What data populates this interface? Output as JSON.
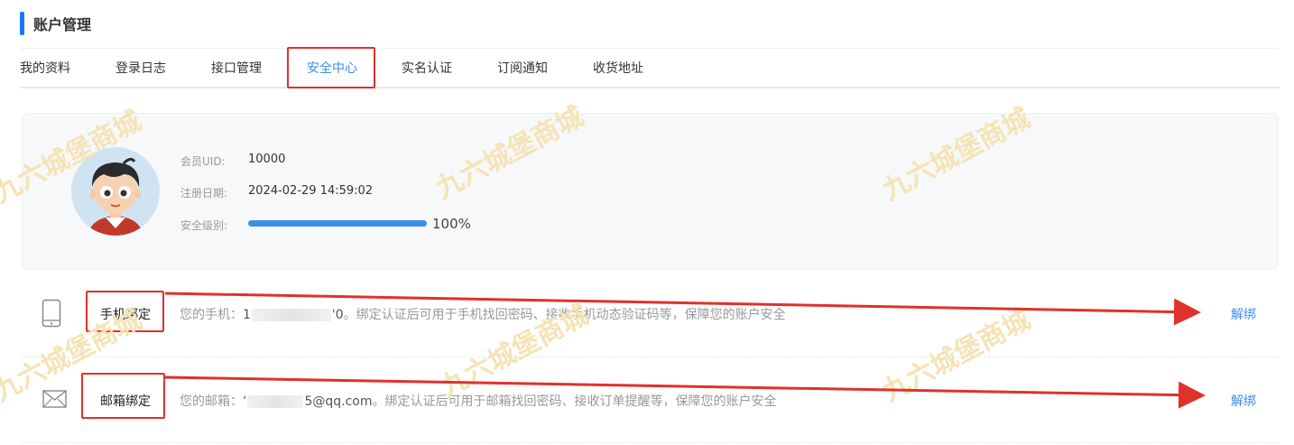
{
  "header": {
    "title": "账户管理"
  },
  "tabs": [
    {
      "label": "我的资料",
      "active": false
    },
    {
      "label": "登录日志",
      "active": false
    },
    {
      "label": "接口管理",
      "active": false
    },
    {
      "label": "安全中心",
      "active": true
    },
    {
      "label": "实名认证",
      "active": false
    },
    {
      "label": "订阅通知",
      "active": false
    },
    {
      "label": "收货地址",
      "active": false
    }
  ],
  "profile": {
    "uid_label": "会员UID:",
    "uid_value": "10000",
    "register_label": "注册日期:",
    "register_value": "2024-02-29 14:59:02",
    "security_label": "安全级别:",
    "security_level": 1.0,
    "security_text": "100%"
  },
  "bindings": {
    "phone": {
      "icon": "phone-icon",
      "title": "手机绑定",
      "prefix": "您的手机：",
      "masked_start": "1",
      "masked_end": "'0",
      "suffix": "。绑定认证后可用于手机找回密码、接收手机动态验证码等，保障您的账户安全",
      "action": "解绑"
    },
    "email": {
      "icon": "envelope-icon",
      "title": "邮箱绑定",
      "prefix": "您的邮箱：",
      "masked_start": "‘",
      "masked_end": "5@qq.com",
      "suffix": "。绑定认证后可用于邮箱找回密码、接收订单提醒等，保障您的账户安全",
      "action": "解绑"
    }
  },
  "watermark_text": "九六城堡商城",
  "colors": {
    "accent": "#1677ff",
    "link": "#3d8ee8",
    "annotation": "#e0312b",
    "watermark": "#f6e3b6"
  }
}
